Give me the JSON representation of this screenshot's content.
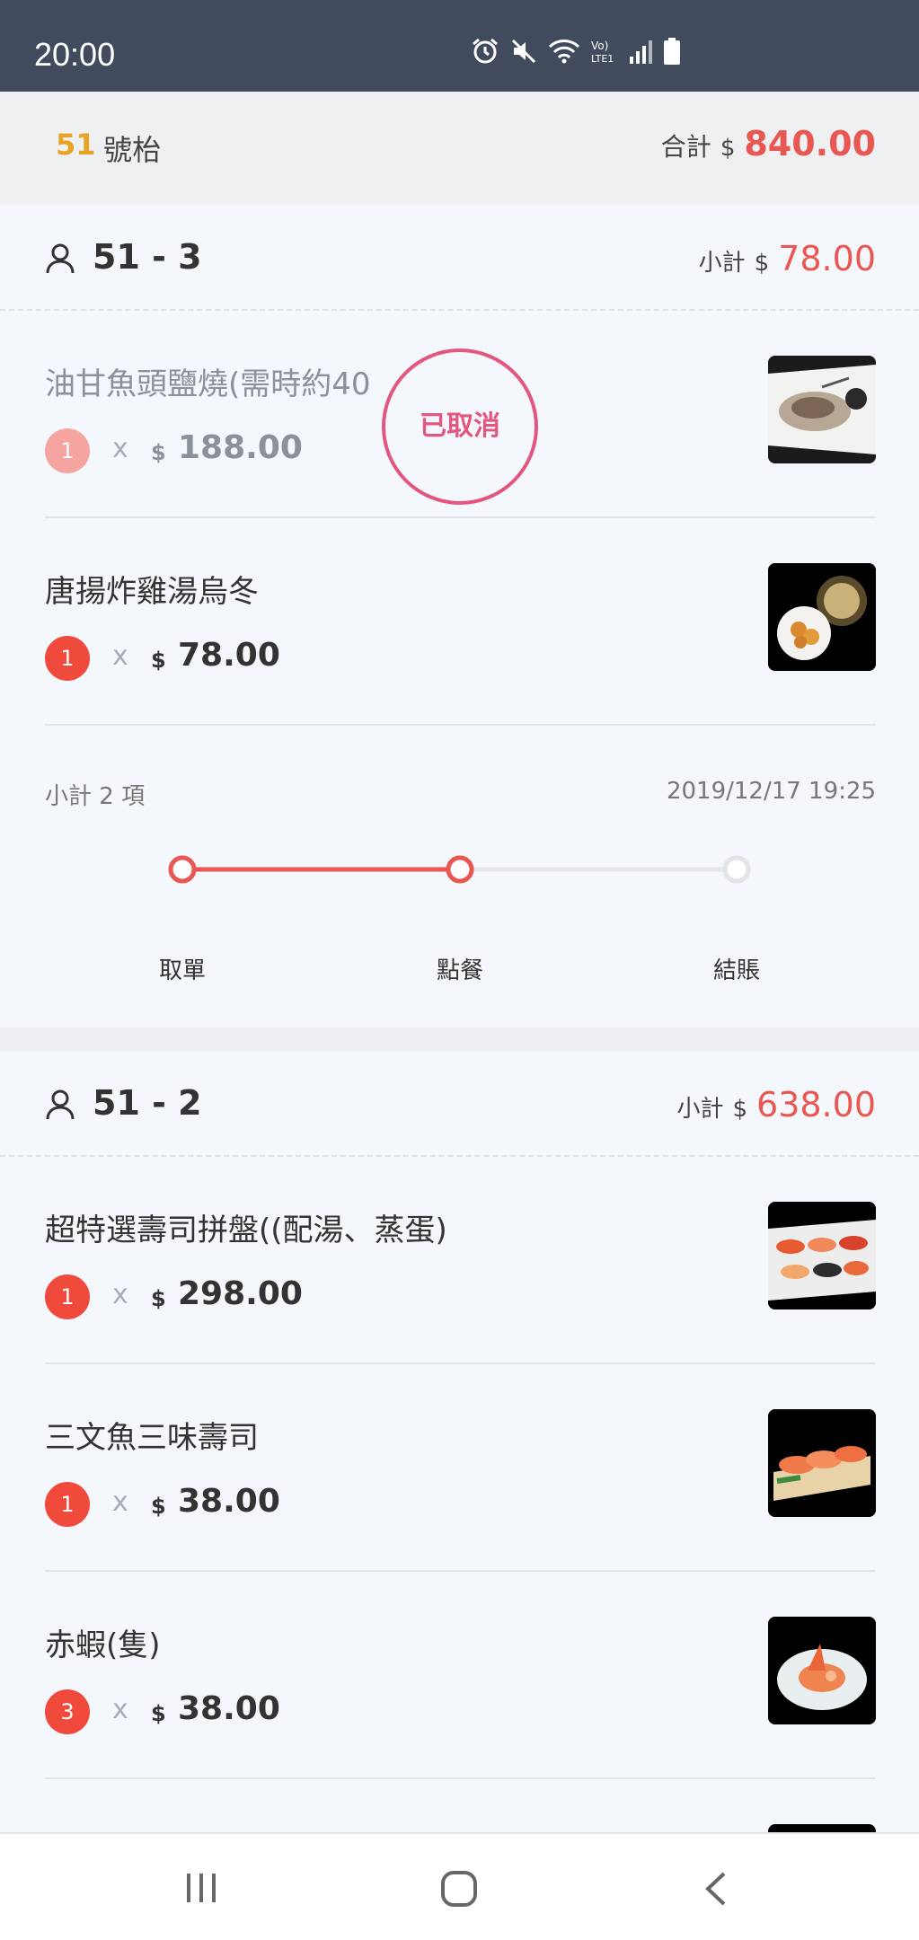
{
  "status_bar": {
    "time": "20:00"
  },
  "table": {
    "number": "51",
    "unit": "號枱",
    "total_label": "合計",
    "currency": "$",
    "total": "840.00"
  },
  "orders": [
    {
      "id": "51 - 3",
      "subtotal_label": "小計",
      "currency": "$",
      "subtotal": "78.00",
      "items": [
        {
          "name": "油甘魚頭鹽燒(需時約40",
          "qty": "1",
          "x": "x",
          "currency": "$",
          "price": "188.00",
          "cancelled": true,
          "stamp": "已取消",
          "thumb": "grilled-fish-head"
        },
        {
          "name": "唐揚炸雞湯烏冬",
          "qty": "1",
          "x": "x",
          "currency": "$",
          "price": "78.00",
          "cancelled": false,
          "thumb": "fried-chicken-udon"
        }
      ],
      "summary": {
        "count_label": "小計 2 項",
        "datetime": "2019/12/17 19:25"
      },
      "progress": {
        "steps": [
          "取單",
          "點餐",
          "結賬"
        ],
        "current_step": 2
      }
    },
    {
      "id": "51 - 2",
      "subtotal_label": "小計",
      "currency": "$",
      "subtotal": "638.00",
      "items": [
        {
          "name": "超特選壽司拼盤((配湯、蒸蛋)",
          "qty": "1",
          "x": "x",
          "currency": "$",
          "price": "298.00",
          "thumb": "sushi-platter"
        },
        {
          "name": "三文魚三味壽司",
          "qty": "1",
          "x": "x",
          "currency": "$",
          "price": "38.00",
          "thumb": "salmon-sushi"
        },
        {
          "name": "赤蝦(隻)",
          "qty": "3",
          "x": "x",
          "currency": "$",
          "price": "38.00",
          "thumb": "red-shrimp"
        }
      ]
    }
  ],
  "colors": {
    "accent": "#e95752",
    "table_no": "#e8a323",
    "status_bar": "#424b5e",
    "stamp": "#e1577f"
  }
}
